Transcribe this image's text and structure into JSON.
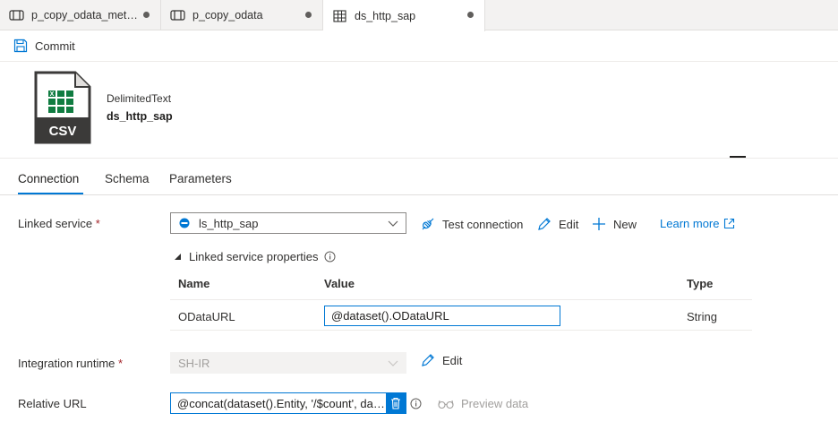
{
  "tabs": [
    {
      "label": "p_copy_odata_meta...",
      "icon": "pipeline-icon",
      "modified": true
    },
    {
      "label": "p_copy_odata",
      "icon": "pipeline-icon",
      "modified": true
    },
    {
      "label": "ds_http_sap",
      "icon": "dataset-table-icon",
      "modified": true,
      "active": true
    }
  ],
  "toolbar": {
    "commit_label": "Commit"
  },
  "dataset": {
    "type": "DelimitedText",
    "name": "ds_http_sap",
    "icon": "csv-file-icon",
    "icon_text": "CSV"
  },
  "subtabs": [
    "Connection",
    "Schema",
    "Parameters"
  ],
  "form": {
    "linked_service_label": "Linked service",
    "linked_service_value": "ls_http_sap",
    "test_connection": "Test connection",
    "edit": "Edit",
    "new": "New",
    "learn_more": "Learn more",
    "lsp_title": "Linked service properties",
    "columns": [
      "Name",
      "Value",
      "Type"
    ],
    "rows": [
      {
        "name": "ODataURL",
        "value": "@dataset().ODataURL",
        "type": "String"
      }
    ],
    "ir_label": "Integration runtime",
    "ir_value": "SH-IR",
    "ir_edit": "Edit",
    "relative_url_label": "Relative URL",
    "relative_url_value": "@concat(dataset().Entity, '/$count', dat...",
    "preview_data": "Preview data",
    "required_mark": "*"
  },
  "colors": {
    "accent": "#0078d4",
    "excel_green": "#107c41",
    "required": "#a4262c"
  }
}
